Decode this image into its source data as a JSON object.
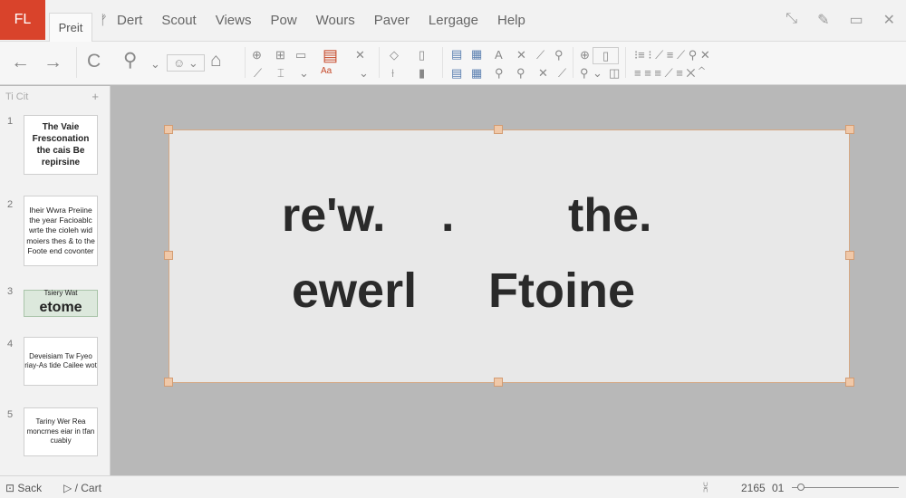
{
  "app": {
    "button_label": "FL"
  },
  "tabs": {
    "active": "Preit"
  },
  "menu": {
    "glyph": "ᚠ",
    "items": [
      "Dert",
      "Scout",
      "Views",
      "Pow",
      "Wours",
      "Paver",
      "Lergage",
      "Help"
    ]
  },
  "toolbar_right": {
    "icons": [
      "resize-icon",
      "pen-icon",
      "display-icon",
      "close-icon"
    ]
  },
  "ribbon": {
    "undo_icon": "←",
    "redo_icon": "→",
    "repeat_icon": "C",
    "home_icon": "⌂",
    "red_label": "Aa"
  },
  "panel": {
    "header": "Ti Cit",
    "plus": "+"
  },
  "slides": [
    {
      "num": "1",
      "text": "The Vaie Fresconation the cais Be repirsine"
    },
    {
      "num": "2",
      "text": "Iheir Wwra Preiine the year Facioablc wrte the cioleh wid moiers thes & to the Foote end covonter"
    },
    {
      "num": "3",
      "small": "Tsiery Wat",
      "big": "etome"
    },
    {
      "num": "4",
      "text": "Deveisiam Tw Fyeo riay-As tide Cailee wot"
    },
    {
      "num": "5",
      "text": "Tariny Wer Rea moncrnes eiar in tfan cuabiy"
    }
  ],
  "slide_main": {
    "line1": {
      "part1": "re'w.",
      "part2": ".",
      "part3": "the."
    },
    "line2": {
      "part1": "ewerl",
      "part2": "Ftoine"
    }
  },
  "status": {
    "left1": "Sack",
    "left2": "Cart",
    "notes_icon": "⩈",
    "page": "2165",
    "zoom_label": "01",
    "zoom_level": 0.05
  },
  "colors": {
    "accent": "#d9432b",
    "selection": "#d5a884"
  }
}
